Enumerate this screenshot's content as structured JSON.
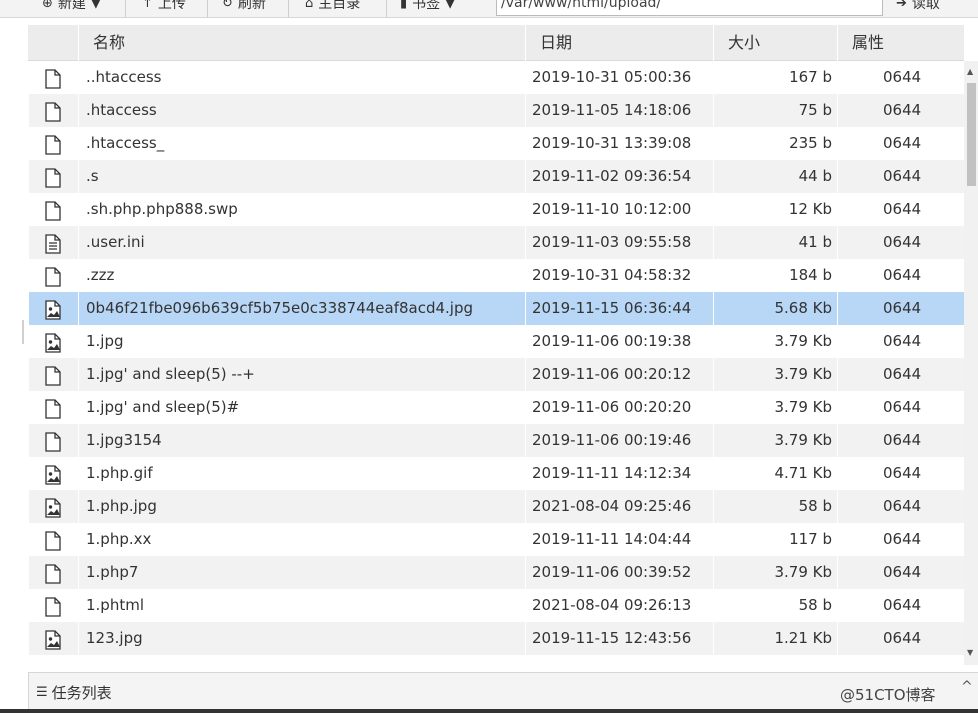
{
  "toolbar": {
    "new_label": "新建",
    "upload_label": "上传",
    "refresh_label": "刷新",
    "home_label": "主目录",
    "bookmark_label": "书签",
    "path_value": "/var/www/html/upload/",
    "read_label": "读取"
  },
  "table": {
    "headers": {
      "name": "名称",
      "date": "日期",
      "size": "大小",
      "attr": "属性"
    },
    "rows": [
      {
        "icon": "file-icon",
        "name": "..htaccess",
        "date": "2019-10-31 05:00:36",
        "size": "167 b",
        "attr": "0644"
      },
      {
        "icon": "file-icon",
        "name": ".htaccess",
        "date": "2019-11-05 14:18:06",
        "size": "75 b",
        "attr": "0644"
      },
      {
        "icon": "file-icon",
        "name": ".htaccess_",
        "date": "2019-10-31 13:39:08",
        "size": "235 b",
        "attr": "0644"
      },
      {
        "icon": "file-icon",
        "name": ".s",
        "date": "2019-11-02 09:36:54",
        "size": "44 b",
        "attr": "0644"
      },
      {
        "icon": "file-icon",
        "name": ".sh.php.php888.swp",
        "date": "2019-11-10 10:12:00",
        "size": "12 Kb",
        "attr": "0644"
      },
      {
        "icon": "text-file-icon",
        "name": ".user.ini",
        "date": "2019-11-03 09:55:58",
        "size": "41 b",
        "attr": "0644"
      },
      {
        "icon": "file-icon",
        "name": ".zzz",
        "date": "2019-10-31 04:58:32",
        "size": "184 b",
        "attr": "0644"
      },
      {
        "icon": "image-file-icon",
        "name": "0b46f21fbe096b639cf5b75e0c338744eaf8acd4.jpg",
        "date": "2019-11-15 06:36:44",
        "size": "5.68 Kb",
        "attr": "0644",
        "selected": true
      },
      {
        "icon": "image-file-icon",
        "name": "1.jpg",
        "date": "2019-11-06 00:19:38",
        "size": "3.79 Kb",
        "attr": "0644"
      },
      {
        "icon": "file-icon",
        "name": "1.jpg' and sleep(5) --+",
        "date": "2019-11-06 00:20:12",
        "size": "3.79 Kb",
        "attr": "0644"
      },
      {
        "icon": "file-icon",
        "name": "1.jpg' and sleep(5)#",
        "date": "2019-11-06 00:20:20",
        "size": "3.79 Kb",
        "attr": "0644"
      },
      {
        "icon": "file-icon",
        "name": "1.jpg3154",
        "date": "2019-11-06 00:19:46",
        "size": "3.79 Kb",
        "attr": "0644"
      },
      {
        "icon": "image-file-icon",
        "name": "1.php.gif",
        "date": "2019-11-11 14:12:34",
        "size": "4.71 Kb",
        "attr": "0644"
      },
      {
        "icon": "image-file-icon",
        "name": "1.php.jpg",
        "date": "2021-08-04 09:25:46",
        "size": "58 b",
        "attr": "0644"
      },
      {
        "icon": "file-icon",
        "name": "1.php.xx",
        "date": "2019-11-11 14:04:44",
        "size": "117 b",
        "attr": "0644"
      },
      {
        "icon": "file-icon",
        "name": "1.php7",
        "date": "2019-11-06 00:39:52",
        "size": "3.79 Kb",
        "attr": "0644"
      },
      {
        "icon": "file-icon",
        "name": "1.phtml",
        "date": "2021-08-04 09:26:13",
        "size": "58 b",
        "attr": "0644"
      },
      {
        "icon": "image-file-icon",
        "name": "123.jpg",
        "date": "2019-11-15 12:43:56",
        "size": "1.21 Kb",
        "attr": "0644"
      }
    ]
  },
  "taskbar": {
    "label": "任务列表"
  },
  "watermark": "@51CTO博客",
  "colors": {
    "selected_row": "#b8d7f7",
    "alt_row": "#f2f2f2",
    "header_bg": "#ececec"
  }
}
